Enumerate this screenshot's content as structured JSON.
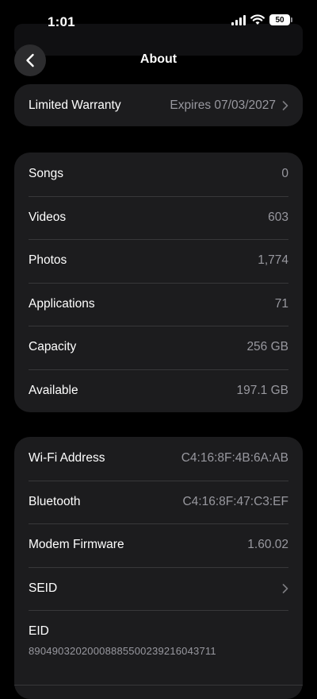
{
  "status_bar": {
    "time": "1:01",
    "battery": "50"
  },
  "nav": {
    "title": "About"
  },
  "warranty": {
    "label": "Limited Warranty",
    "value": "Expires 07/03/2027"
  },
  "stats": [
    {
      "label": "Songs",
      "value": "0"
    },
    {
      "label": "Videos",
      "value": "603"
    },
    {
      "label": "Photos",
      "value": "1,774"
    },
    {
      "label": "Applications",
      "value": "71"
    },
    {
      "label": "Capacity",
      "value": "256 GB"
    },
    {
      "label": "Available",
      "value": "197.1 GB"
    }
  ],
  "network": {
    "wifi": {
      "label": "Wi-Fi Address",
      "value": "C4:16:8F:4B:6A:AB"
    },
    "bluetooth": {
      "label": "Bluetooth",
      "value": "C4:16:8F:47:C3:EF"
    },
    "modem": {
      "label": "Modem Firmware",
      "value": "1.60.02"
    },
    "seid": {
      "label": "SEID"
    },
    "eid": {
      "label": "EID",
      "value": "89049032020008885500239216043711"
    }
  },
  "colors": {
    "background": "#000000",
    "card": "#1c1c1e",
    "secondary_text": "#98989f"
  }
}
